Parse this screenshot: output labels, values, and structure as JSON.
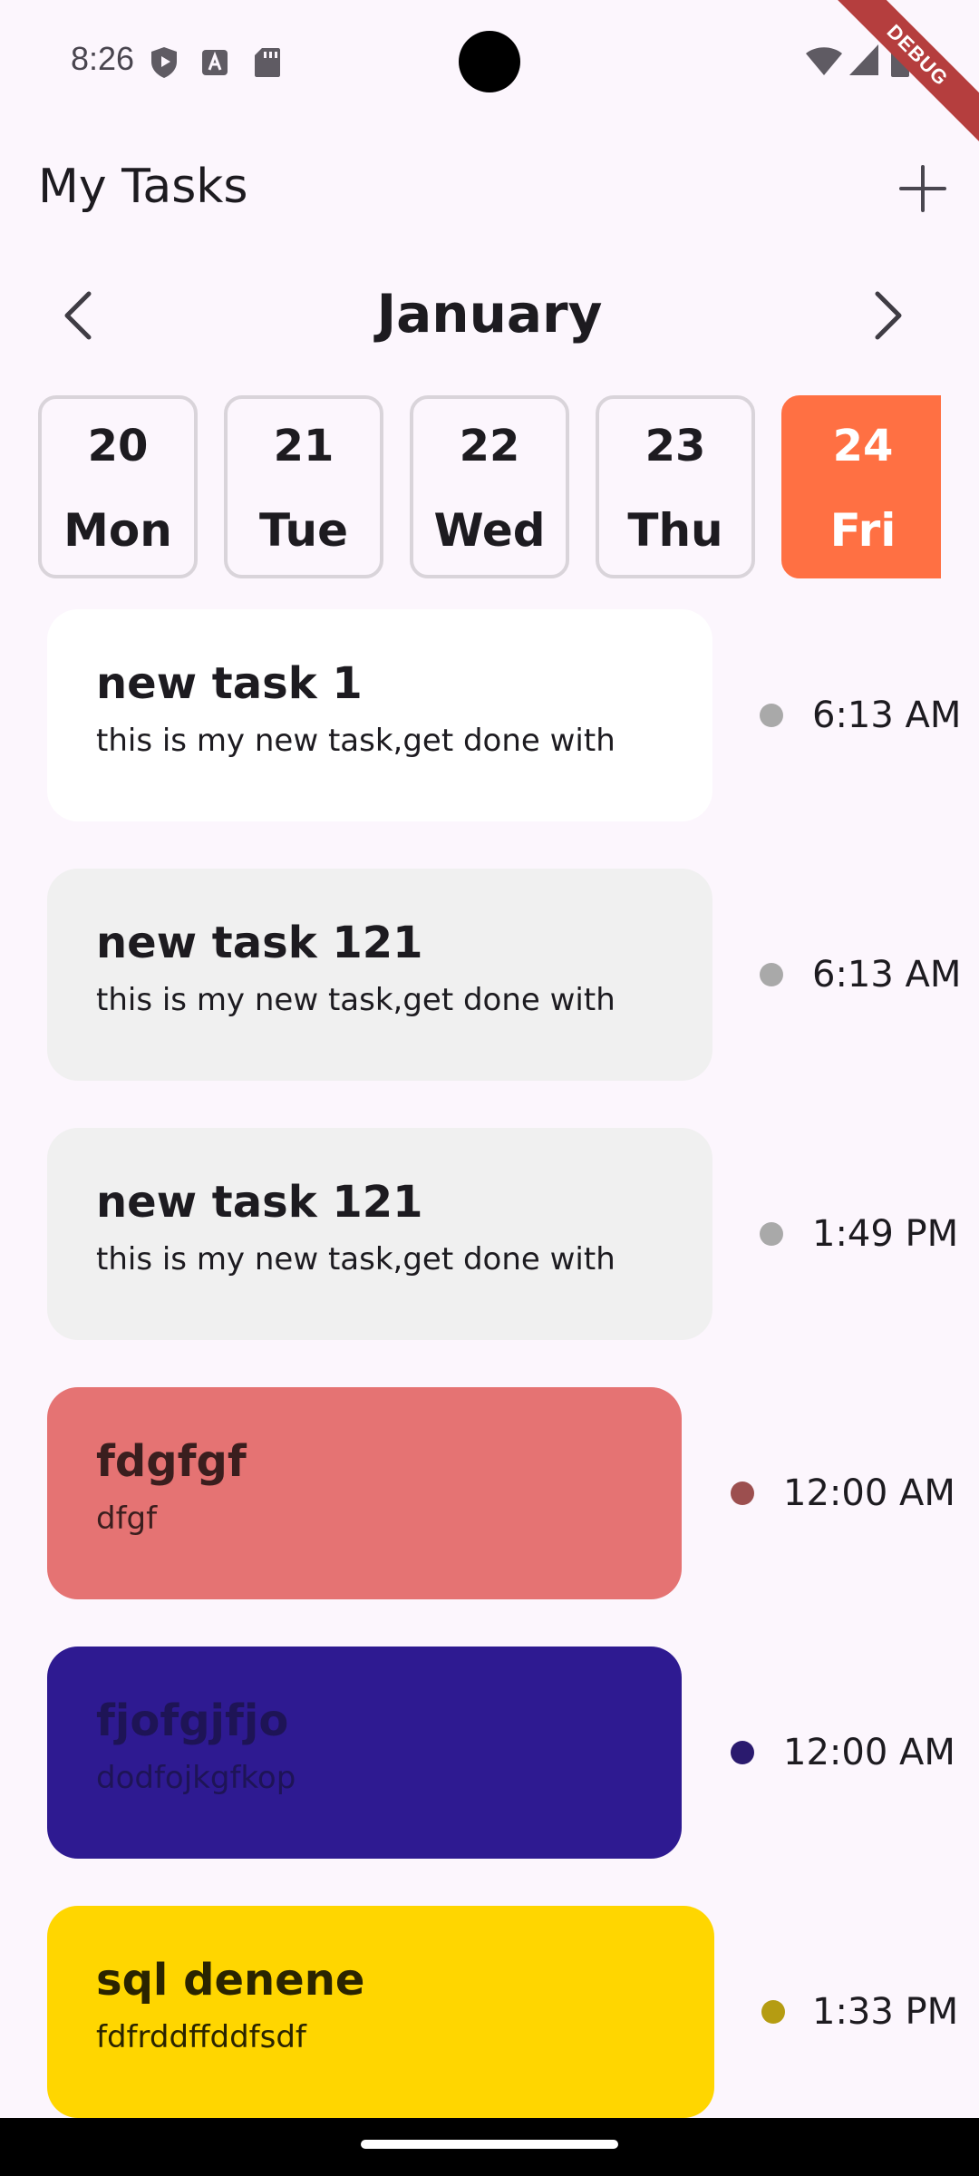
{
  "status_bar": {
    "time": "8:26",
    "icons": [
      "shield-icon",
      "text-a-icon",
      "sd-card-icon",
      "wifi-icon",
      "signal-icon",
      "battery-icon"
    ]
  },
  "debug_banner": "DEBUG",
  "header": {
    "title": "My Tasks",
    "add_icon": "plus-icon"
  },
  "calendar": {
    "month": "January",
    "prev_icon": "chevron-left-icon",
    "next_icon": "chevron-right-icon",
    "days": [
      {
        "num": "20",
        "day": "Mon",
        "selected": false
      },
      {
        "num": "21",
        "day": "Tue",
        "selected": false
      },
      {
        "num": "22",
        "day": "Wed",
        "selected": false
      },
      {
        "num": "23",
        "day": "Thu",
        "selected": false
      },
      {
        "num": "24",
        "day": "Fri",
        "selected": true
      }
    ],
    "selected_color": "#FF7043"
  },
  "tasks": [
    {
      "title": "new task 1",
      "description": "this is my new task,get done with",
      "time": "6:13 AM",
      "card_color": "#FFFFFF",
      "dot_color": "#A9A9A9"
    },
    {
      "title": "new task 121",
      "description": "this is my new task,get done with",
      "time": "6:13 AM",
      "card_color": "#F0F0F0",
      "dot_color": "#A9A9A9"
    },
    {
      "title": "new task 121",
      "description": "this is my new task,get done with",
      "time": "1:49 PM",
      "card_color": "#F0F0F0",
      "dot_color": "#A9A9A9"
    },
    {
      "title": "fdgfgf",
      "description": "dfgf",
      "time": "12:00 AM",
      "card_color": "#E57373",
      "dot_color": "#9C4F4F"
    },
    {
      "title": "fjofgjfjo",
      "description": "dodfojkgfkop",
      "time": "12:00 AM",
      "card_color": "#2E1A91",
      "dot_color": "#2A1A6E"
    },
    {
      "title": "sql denene",
      "description": "fdfrddffddfsdf",
      "time": "1:33 PM",
      "card_color": "#FFD600",
      "dot_color": "#B59C12"
    }
  ]
}
